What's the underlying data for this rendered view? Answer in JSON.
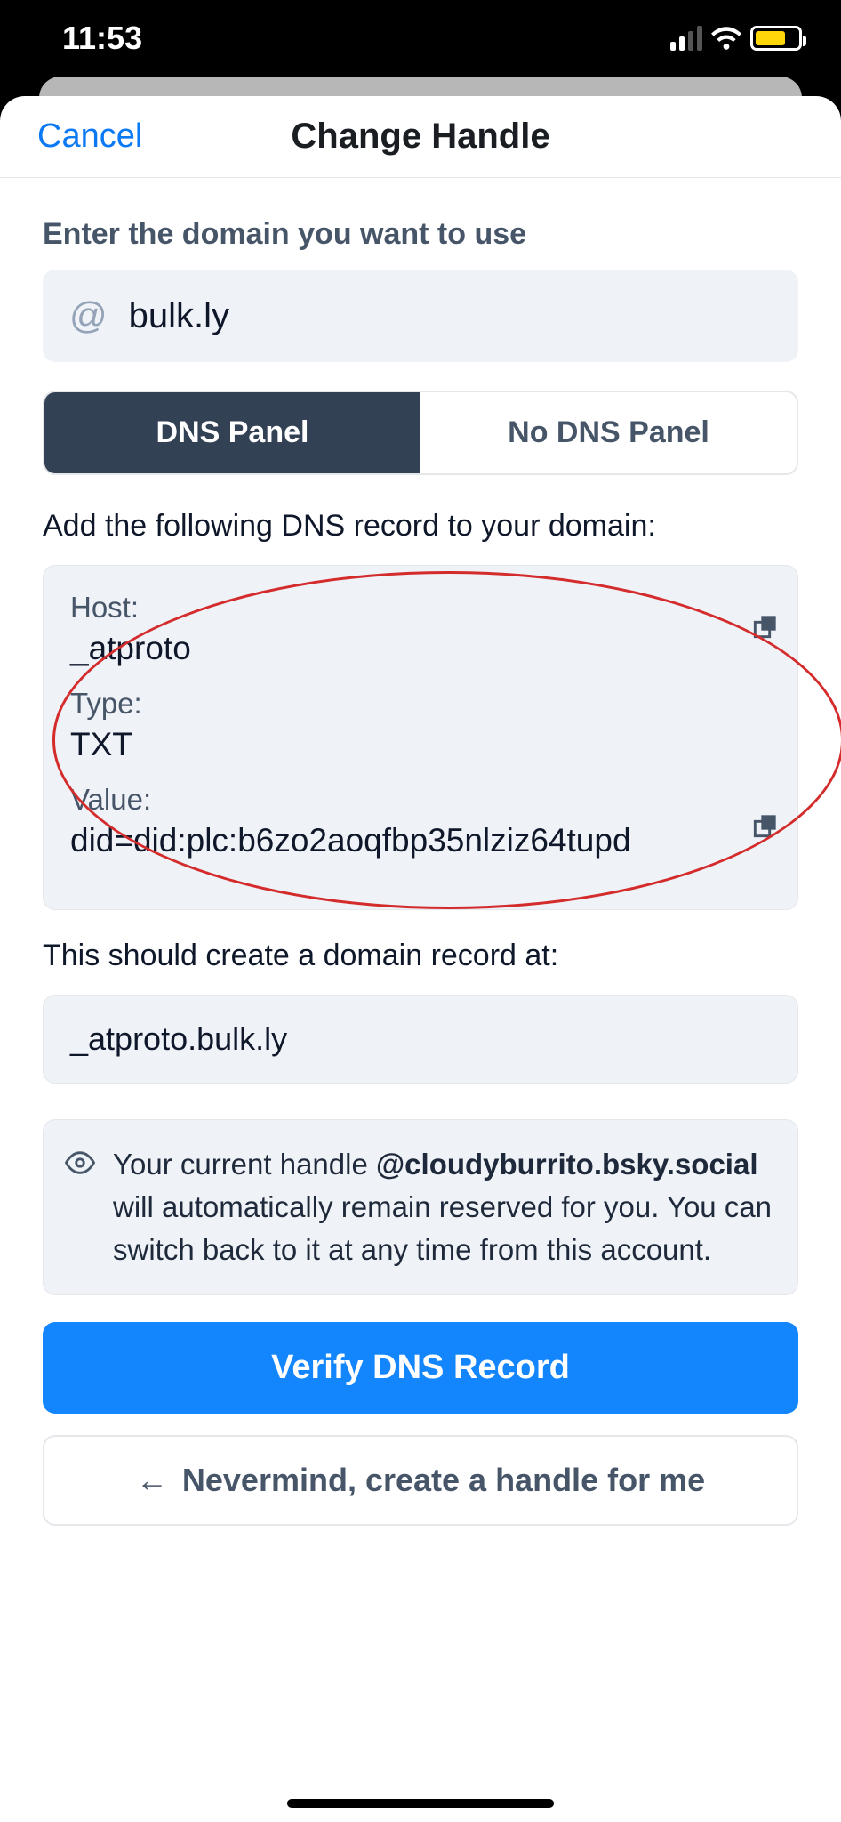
{
  "status": {
    "time": "11:53"
  },
  "nav": {
    "cancel": "Cancel",
    "title": "Change Handle"
  },
  "domain": {
    "label": "Enter the domain you want to use",
    "at": "@",
    "value": "bulk.ly"
  },
  "tabs": {
    "dns": "DNS Panel",
    "nodns": "No DNS Panel"
  },
  "dns": {
    "instruction": "Add the following DNS record to your domain:",
    "host_label": "Host:",
    "host_value": "_atproto",
    "type_label": "Type:",
    "type_value": "TXT",
    "value_label": "Value:",
    "value_value": "did=did:plc:b6zo2aoqfbp35nlziz64tupd"
  },
  "record": {
    "label": "This should create a domain record at:",
    "value": "_atproto.bulk.ly"
  },
  "notice": {
    "pre": "Your current handle ",
    "handle": "@cloudyburrito.bsky.social",
    "post": " will automatically remain reserved for you. You can switch back to it at any time from this account."
  },
  "buttons": {
    "verify": "Verify DNS Record",
    "back": "Nevermind, create a handle for me",
    "arrow": "←"
  }
}
